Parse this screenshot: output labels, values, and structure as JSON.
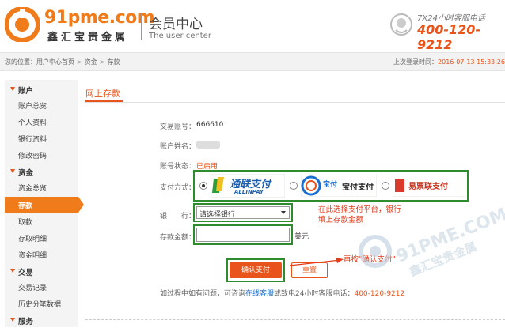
{
  "brand": {
    "logo_en": "91pme.com",
    "logo_cn": "鑫汇宝贵金属",
    "uc_cn": "会员中心",
    "uc_en": "The user center",
    "hotline_label": "7X24小时客服电话",
    "hotline_number": "400-120-9212",
    "accent": "#f07b1a"
  },
  "breadcrumb": {
    "prefix": "您的位置：",
    "items": [
      "用户中心首页",
      "资金",
      "存款"
    ],
    "separator": ">"
  },
  "last_login": {
    "label": "上次登录时间：",
    "time": "2016-07-13 15:33:26"
  },
  "sidebar": {
    "groups": [
      {
        "label": "账户",
        "items": [
          "账户总览",
          "个人资料",
          "银行资料",
          "修改密码"
        ]
      },
      {
        "label": "资金",
        "items": [
          "资金总览",
          "存款",
          "取款",
          "存取明细",
          "资金明细"
        ]
      },
      {
        "label": "交易",
        "items": [
          "交易记录",
          "历史分笔数据"
        ]
      },
      {
        "label": "服务",
        "items": []
      }
    ],
    "active_item": "存款"
  },
  "panel": {
    "title": "网上存款",
    "account_label": "交易账号：",
    "account_value": "666610",
    "name_label": "账户姓名：",
    "status_label": "账号状态：",
    "status_value": "已启用",
    "pay_label": "支付方式：",
    "pay_options": [
      {
        "name": "通联支付",
        "sub": "ALLINPAY",
        "icon": "allinpay-logo",
        "selected": true
      },
      {
        "name": "宝付",
        "sub": "宝付支付",
        "icon": "baofoo-logo",
        "selected": false
      },
      {
        "name": "易票联支付",
        "icon": "easylink-logo",
        "selected": false
      }
    ],
    "bank_label": "银　　行：",
    "bank_select_value": "请选择银行",
    "amount_label": "存款金额：",
    "amount_value": "",
    "amount_unit": "美元",
    "confirm_label": "确认支付",
    "reset_label": "重置",
    "help_prefix": "如过程中如有问题，可咨询",
    "help_link": "在线客服",
    "help_mid": "或致电24小时客服电话：",
    "help_phone": "400-120-9212"
  },
  "annotations": {
    "note_line1": "在此选择支付平台，银行",
    "note_line2": "填上存款金额",
    "confirm_hint": "再按\"确认支付\"",
    "color": "#e23a1a"
  },
  "watermark": {
    "text": "91PME.COM",
    "cn": "鑫汇宝贵金属"
  }
}
